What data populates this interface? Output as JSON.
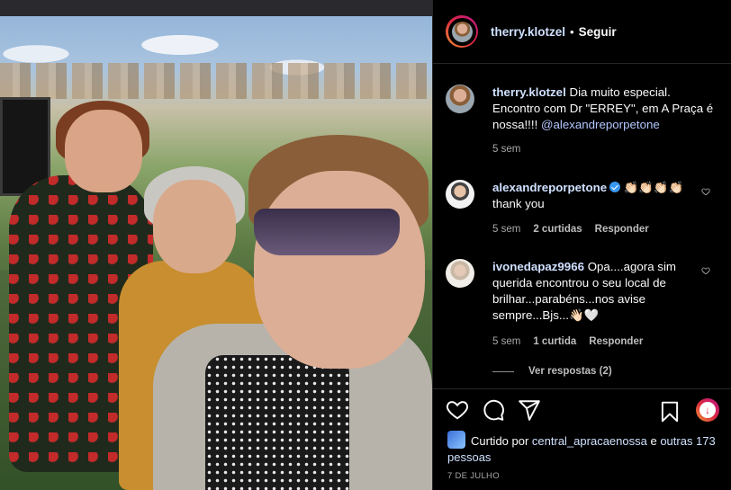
{
  "post": {
    "author": "therry.klotzel",
    "follow_sep": "•",
    "follow_label": "Seguir"
  },
  "caption": {
    "user": "therry.klotzel",
    "text": "Dia muito especial. Encontro com Dr \"ERREY\", em A Praça é nossa!!!! ",
    "mention": "@alexandreporpetone",
    "time": "5 sem"
  },
  "comments": [
    {
      "user": "alexandreporpetone",
      "verified": true,
      "text_line1": " 👏🏻👏🏻👏🏻👏🏻",
      "text_line2": "thank you",
      "time": "5 sem",
      "likes": "2 curtidas",
      "reply": "Responder"
    },
    {
      "user": "ivonedapaz9966",
      "text": " Opa....agora sim querida encontrou o seu local de brilhar...parabéns...nos avise sempre...Bjs...👋🏻🤍",
      "time": "5 sem",
      "likes": "1 curtida",
      "reply": "Responder"
    }
  ],
  "view_replies": "Ver respostas (2)",
  "likes": {
    "prefix": "Curtido por ",
    "user": "central_apracaenossa",
    "connector": " e ",
    "others": "outras 173 pessoas"
  },
  "date": "7 DE JULHO",
  "icons": [
    "heart-icon",
    "comment-icon",
    "share-icon",
    "bookmark-icon",
    "promo-icon"
  ]
}
